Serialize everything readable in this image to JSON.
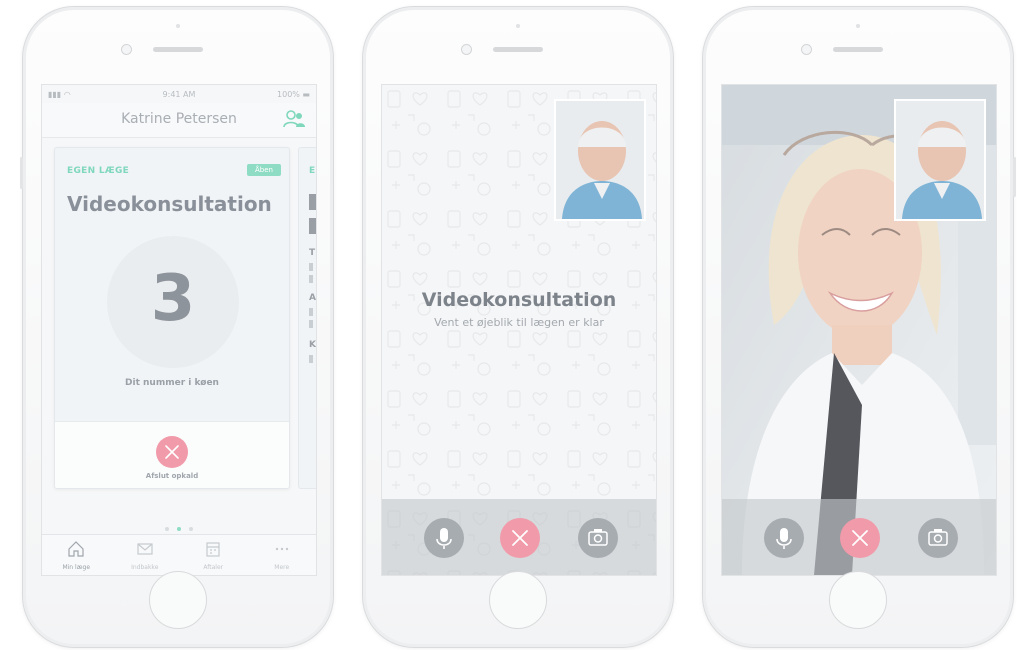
{
  "phone1": {
    "status": {
      "time": "9:41 AM",
      "battery": "100%"
    },
    "header": {
      "user_name": "Katrine Petersen"
    },
    "card": {
      "label": "EGEN LÆGE",
      "badge": "Åben",
      "title": "Videokonsultation",
      "queue_number": "3",
      "queue_label": "Dit nummer i køen",
      "end_call": "Afslut opkald"
    },
    "next_card": {
      "label": "E",
      "letters": [
        "T",
        "A",
        "K"
      ]
    },
    "tabs": [
      {
        "label": "Min læge",
        "icon": "home-icon"
      },
      {
        "label": "Indbakke",
        "icon": "mail-icon"
      },
      {
        "label": "Aftaler",
        "icon": "calendar-icon"
      },
      {
        "label": "Mere",
        "icon": "more-icon"
      }
    ]
  },
  "phone2": {
    "title": "Videokonsultation",
    "subtitle": "Vent et øjeblik til lægen er klar"
  },
  "colors": {
    "accent": "#7fd7bc",
    "end_call": "#f19aaa",
    "control_gray": "#a7acb1"
  }
}
